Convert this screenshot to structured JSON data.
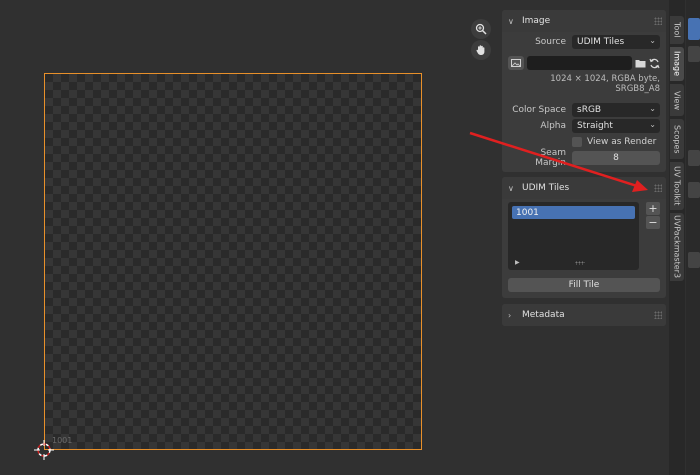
{
  "viewport": {
    "tile_label": "1001"
  },
  "image_panel": {
    "header": "Image",
    "source_label": "Source",
    "source_value": "UDIM Tiles",
    "info": "1024 × 1024,  RGBA byte, SRGB8_A8",
    "color_space_label": "Color Space",
    "color_space_value": "sRGB",
    "alpha_label": "Alpha",
    "alpha_value": "Straight",
    "view_as_render_label": "View as Render",
    "seam_margin_label": "Seam Margin",
    "seam_margin_value": "8"
  },
  "udim_panel": {
    "header": "UDIM Tiles",
    "tiles": [
      "1001"
    ],
    "add_label": "+",
    "remove_label": "−",
    "fill_tile_label": "Fill Tile"
  },
  "metadata_panel": {
    "header": "Metadata"
  },
  "tabs": [
    "Tool",
    "Image",
    "View",
    "Scopes",
    "UV Toolkit",
    "UVPackmaster3"
  ],
  "colors": {
    "tile_border": "#e8902a",
    "selection": "#4772b3",
    "annotation_arrow": "#e02020"
  }
}
